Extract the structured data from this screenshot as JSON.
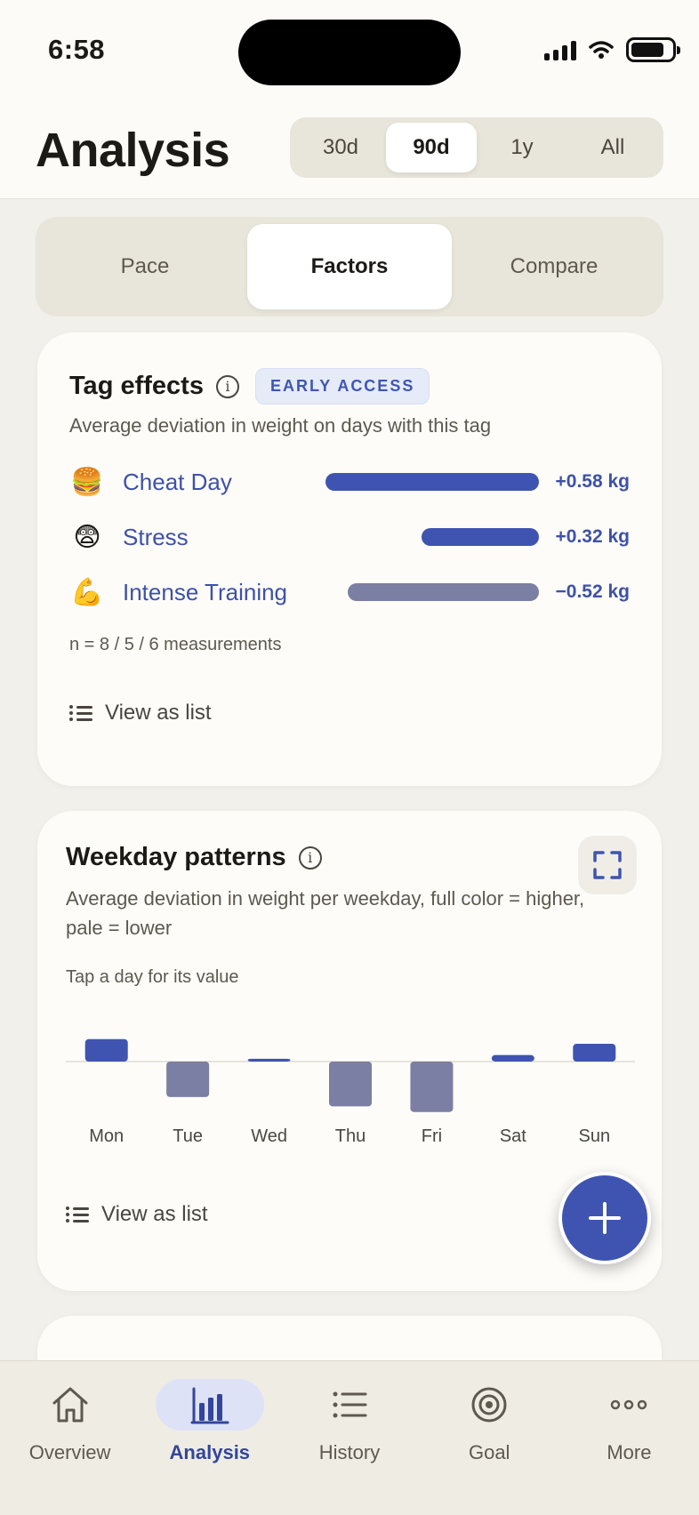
{
  "status": {
    "time": "6:58"
  },
  "header": {
    "title": "Analysis",
    "ranges": [
      {
        "label": "30d",
        "active": false
      },
      {
        "label": "90d",
        "active": true
      },
      {
        "label": "1y",
        "active": false
      },
      {
        "label": "All",
        "active": false
      }
    ]
  },
  "sub_tabs": [
    {
      "label": "Pace",
      "active": false
    },
    {
      "label": "Factors",
      "active": true
    },
    {
      "label": "Compare",
      "active": false
    }
  ],
  "tag_effects": {
    "title": "Tag effects",
    "badge": "EARLY ACCESS",
    "subtitle": "Average deviation in weight on days with this tag",
    "rows": [
      {
        "emoji": "🍔",
        "label": "Cheat Day",
        "value": 0.58,
        "value_label": "+0.58 kg"
      },
      {
        "emoji": "😨",
        "label": "Stress",
        "value": 0.32,
        "value_label": "+0.32 kg"
      },
      {
        "emoji": "💪",
        "label": "Intense Training",
        "value": -0.52,
        "value_label": "−0.52 kg"
      }
    ],
    "note": "n = 8 / 5 / 6 measurements",
    "view_list": "View as list"
  },
  "weekday_patterns": {
    "title": "Weekday patterns",
    "subtitle": "Average deviation in weight per weekday, full color = higher, pale = lower",
    "hint": "Tap a day for its value",
    "view_list": "View as list"
  },
  "chart_data": {
    "type": "bar",
    "categories": [
      "Mon",
      "Tue",
      "Wed",
      "Thu",
      "Fri",
      "Sat",
      "Sun"
    ],
    "values": [
      0.24,
      -0.38,
      0.03,
      -0.48,
      -0.54,
      0.07,
      0.19
    ],
    "colors": {
      "positive": "#3f54b0",
      "negative": "#7b7fa3"
    }
  },
  "bottom_nav": [
    {
      "label": "Overview",
      "icon": "home-icon",
      "active": false
    },
    {
      "label": "Analysis",
      "icon": "bar-chart-icon",
      "active": true
    },
    {
      "label": "History",
      "icon": "list-icon",
      "active": false
    },
    {
      "label": "Goal",
      "icon": "target-icon",
      "active": false
    },
    {
      "label": "More",
      "icon": "more-icon",
      "active": false
    }
  ],
  "colors": {
    "accent": "#3f54b0",
    "positive_bar": "#3f54b0",
    "negative_bar": "#7b7fa3",
    "background": "#f2f0ea"
  }
}
